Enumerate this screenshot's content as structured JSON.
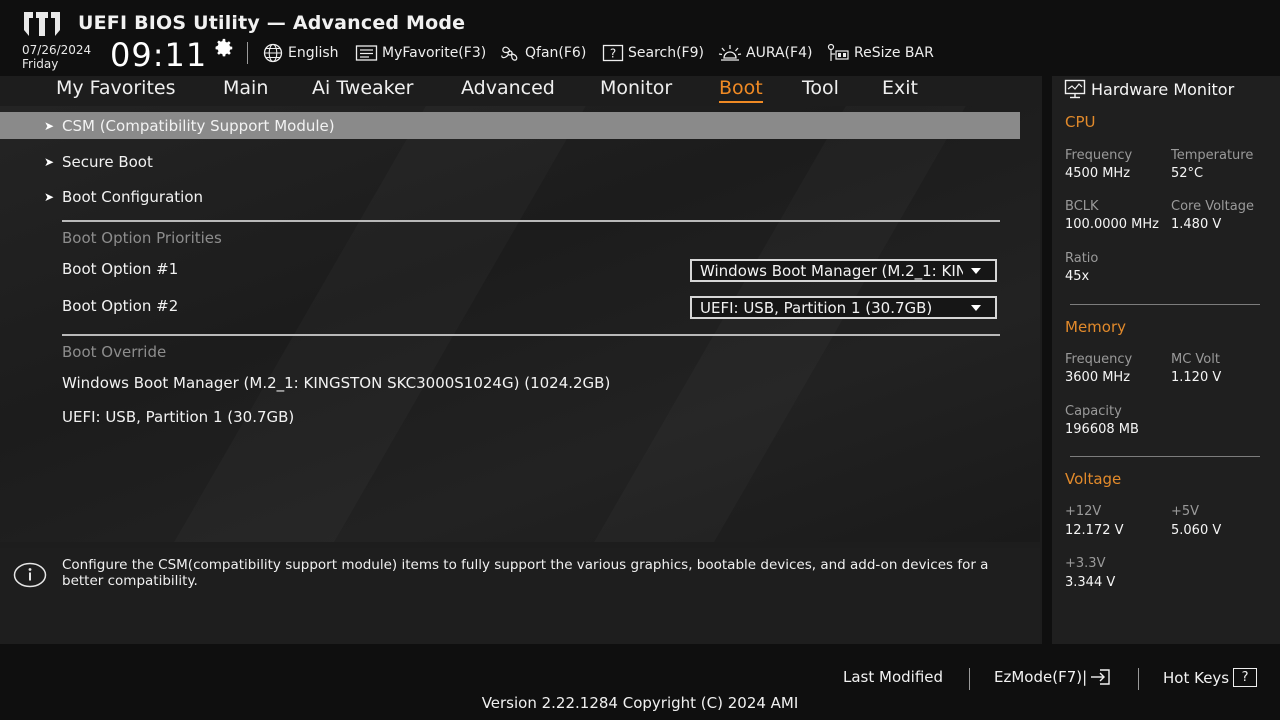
{
  "header": {
    "title": "UEFI BIOS Utility — Advanced Mode",
    "date": "07/26/2024",
    "day": "Friday",
    "time": "09:11",
    "tools": [
      {
        "label": "English",
        "icon": "globe-icon"
      },
      {
        "label": "MyFavorite(F3)",
        "icon": "favorite-list-icon"
      },
      {
        "label": "Qfan(F6)",
        "icon": "fan-icon"
      },
      {
        "label": "Search(F9)",
        "icon": "search-help-icon"
      },
      {
        "label": "AURA(F4)",
        "icon": "aura-light-icon"
      },
      {
        "label": "ReSize BAR",
        "icon": "resize-bar-icon"
      }
    ]
  },
  "nav": {
    "tabs": [
      "My Favorites",
      "Main",
      "Ai Tweaker",
      "Advanced",
      "Monitor",
      "Boot",
      "Tool",
      "Exit"
    ],
    "active": "Boot"
  },
  "main": {
    "submenus": [
      "CSM (Compatibility Support Module)",
      "Secure Boot",
      "Boot Configuration"
    ],
    "priorities_label": "Boot Option Priorities",
    "boot_options": [
      {
        "label": "Boot Option #1",
        "value": "Windows Boot Manager (M.2_1: KINGSTON SKC3000S1024G) (1024.2GB)"
      },
      {
        "label": "Boot Option #2",
        "value": "UEFI:  USB, Partition 1 (30.7GB)"
      }
    ],
    "override_label": "Boot Override",
    "override_items": [
      "Windows Boot Manager (M.2_1: KINGSTON SKC3000S1024G) (1024.2GB)",
      "UEFI:  USB, Partition 1 (30.7GB)"
    ]
  },
  "help": {
    "text": "Configure the CSM(compatibility support module) items to fully support the various graphics, bootable devices, and add-on devices for a better compatibility."
  },
  "hardware_monitor": {
    "title": "Hardware Monitor",
    "cpu": {
      "label": "CPU",
      "frequency_label": "Frequency",
      "frequency": "4500 MHz",
      "temperature_label": "Temperature",
      "temperature": "52°C",
      "bclk_label": "BCLK",
      "bclk": "100.0000 MHz",
      "core_voltage_label": "Core Voltage",
      "core_voltage": "1.480 V",
      "ratio_label": "Ratio",
      "ratio": "45x"
    },
    "memory": {
      "label": "Memory",
      "frequency_label": "Frequency",
      "frequency": "3600 MHz",
      "mc_volt_label": "MC Volt",
      "mc_volt": "1.120 V",
      "capacity_label": "Capacity",
      "capacity": "196608 MB"
    },
    "voltage": {
      "label": "Voltage",
      "v12_label": "+12V",
      "v12": "12.172 V",
      "v5_label": "+5V",
      "v5": "5.060 V",
      "v33_label": "+3.3V",
      "v33": "3.344 V"
    }
  },
  "footer": {
    "last_modified": "Last Modified",
    "ezmode": "EzMode(F7)|",
    "hotkeys": "Hot Keys",
    "hotkeys_key": "?",
    "version": "Version 2.22.1284 Copyright (C) 2024 AMI"
  },
  "colors": {
    "accent": "#f08a24",
    "selected_row": "#8a8a8a",
    "background": "#1d1d1d"
  }
}
